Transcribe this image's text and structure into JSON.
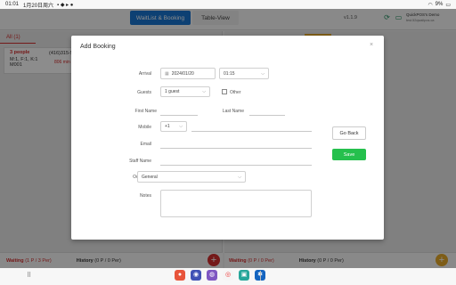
{
  "status_bar": {
    "time": "01:01",
    "date": "1月20日周六",
    "battery": "9%"
  },
  "header": {
    "tab_waitlist": "WaitList & Booking",
    "tab_table": "Table-View",
    "version": "v1.1.9",
    "account_name": "QuickPOS's Demo",
    "account_sub": "test.52qwaitpos.ca"
  },
  "left_panel": {
    "tab_all": "All (1)",
    "card": {
      "people": "3 people",
      "phone": "(416)315-5",
      "detail": "M:1, F:1, K:1",
      "code": "M001",
      "minutes": "806 min"
    },
    "bottom_waiting_label": "Waiting",
    "bottom_waiting_count": "(1 P / 3 Per)",
    "bottom_history_label": "History",
    "bottom_history_count": "(0 P / 0 Per)"
  },
  "right_panel": {
    "date_text": "2024/01/20",
    "bottom_waiting_label": "Waiting",
    "bottom_waiting_count": "(0 P / 0 Per)",
    "bottom_history_label": "History",
    "bottom_history_count": "(0 P / 0 Per)"
  },
  "dialog": {
    "title": "Add Booking",
    "close": "×",
    "arrival_label": "Arrival",
    "arrival_date": "2024/01/20",
    "arrival_time": "01:15",
    "guests_label": "Guests",
    "guests_value": "1 guest",
    "other_label": "Other",
    "first_name_label": "First Name",
    "last_name_label": "Last Name",
    "mobile_label": "Mobile",
    "mobile_code": "+1",
    "email_label": "Email",
    "staff_name_label": "Staff Name",
    "occasion_label": "Occasion",
    "occasion_value": "General",
    "notes_label": "Notes",
    "go_back": "Go Back",
    "save": "Save"
  },
  "colors": {
    "primary": "#1976d2",
    "danger": "#d32f2f",
    "save": "#25c04d",
    "fab_right": "#e5a92b"
  }
}
